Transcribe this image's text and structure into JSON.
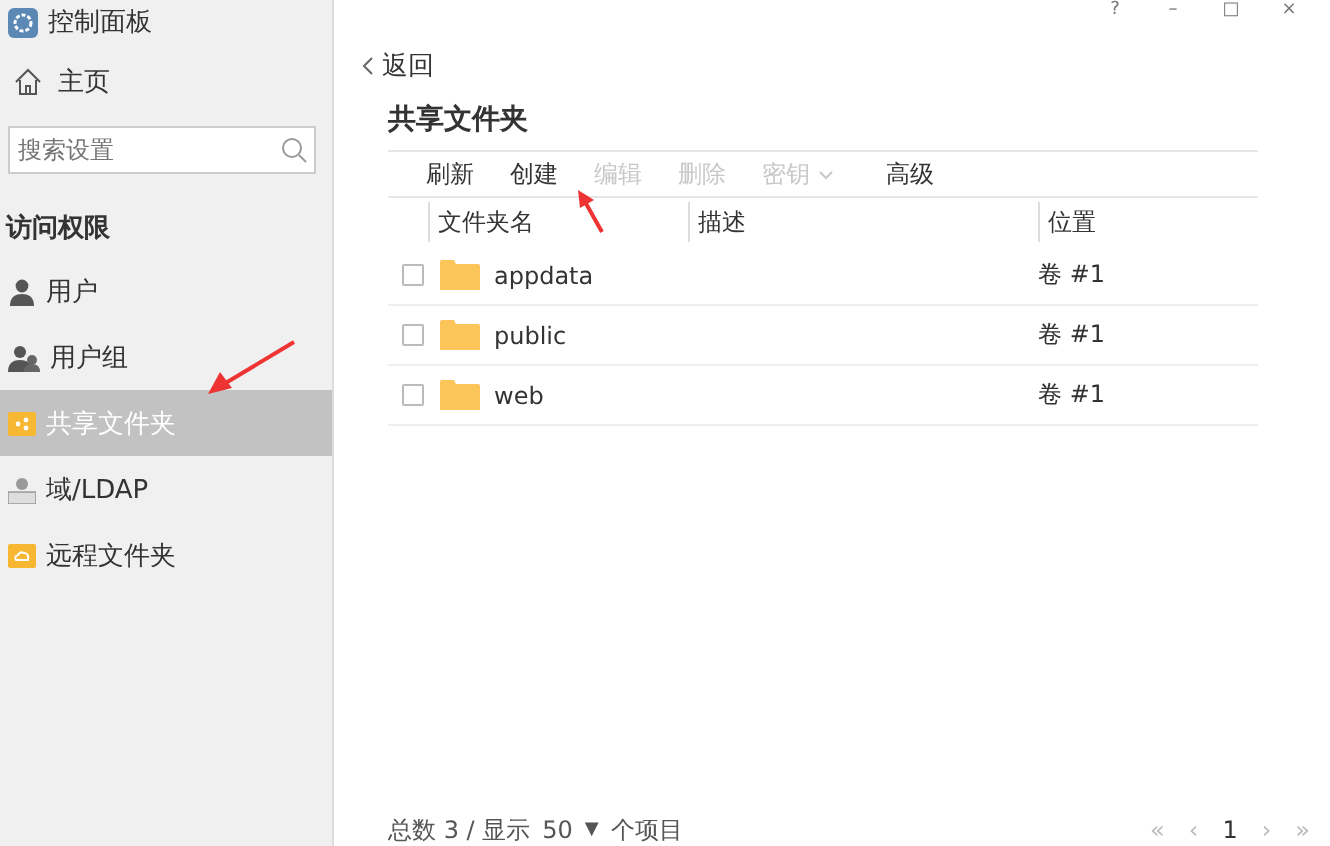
{
  "window": {
    "title": "控制面板",
    "controls": [
      "?",
      "–",
      "□",
      "×"
    ]
  },
  "sidebar": {
    "home": "主页",
    "search": {
      "placeholder": "搜索设置"
    },
    "section": "访问权限",
    "items": [
      {
        "label": "用户",
        "kind": "user",
        "selected": false
      },
      {
        "label": "用户组",
        "kind": "group",
        "selected": false
      },
      {
        "label": "共享文件夹",
        "kind": "share",
        "selected": true
      },
      {
        "label": "域/LDAP",
        "kind": "ldap",
        "selected": false
      },
      {
        "label": "远程文件夹",
        "kind": "remote",
        "selected": false
      }
    ]
  },
  "main": {
    "back": "返回",
    "title": "共享文件夹",
    "toolbar": [
      {
        "label": "刷新",
        "disabled": false,
        "kind": "button"
      },
      {
        "label": "创建",
        "disabled": false,
        "kind": "button"
      },
      {
        "label": "编辑",
        "disabled": true,
        "kind": "button"
      },
      {
        "label": "删除",
        "disabled": true,
        "kind": "button"
      },
      {
        "label": "密钥",
        "disabled": true,
        "kind": "dropdown"
      },
      {
        "label": "高级",
        "disabled": false,
        "kind": "button"
      }
    ],
    "table": {
      "columns": [
        "文件夹名",
        "描述",
        "位置"
      ],
      "rows": [
        {
          "checked": false,
          "name": "appdata",
          "description": "",
          "location": "卷 #1"
        },
        {
          "checked": false,
          "name": "public",
          "description": "",
          "location": "卷 #1"
        },
        {
          "checked": false,
          "name": "web",
          "description": "",
          "location": "卷 #1"
        }
      ]
    },
    "footer": {
      "total": "总数 3 / 显示",
      "page_size": "50",
      "caret": "▼",
      "unit": "个项目",
      "pager": [
        "«",
        "‹",
        "1",
        "›",
        "»"
      ]
    }
  }
}
